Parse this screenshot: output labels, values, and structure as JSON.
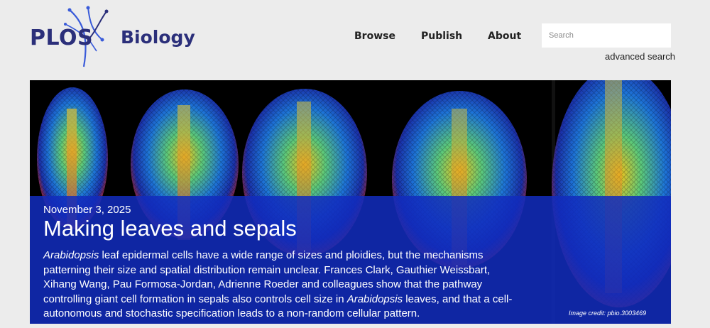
{
  "header": {
    "logo_text": "PLOS",
    "logo_journal": "Biology",
    "nav": {
      "browse": "Browse",
      "publish": "Publish",
      "about": "About"
    },
    "search": {
      "placeholder": "Search",
      "advanced_label": "advanced search"
    }
  },
  "featured": {
    "date": "November 3, 2025",
    "title": "Making leaves and sepals",
    "description": {
      "seg1_italic": "Arabidopsis",
      "seg2": " leaf epidermal cells have a wide range of sizes and ploidies, but the mechanisms patterning their size and spatial distribution remain unclear. Frances Clark, Gauthier Weissbart, Xihang Wang, Pau Formosa-Jordan, Adrienne Roeder and colleagues show that the pathway controlling giant cell formation in sepals also controls cell size in ",
      "seg3_italic": "Arabidopsis",
      "seg4": " leaves, and that a cell-autonomous and stochastic specification leads to a non-random cellular pattern."
    },
    "image_credit": "Image credit: pbio.3003469"
  },
  "colors": {
    "brand_navy": "#2b2f7a",
    "logo_accent": "#3a5bd9",
    "overlay_blue": "#122cbe",
    "page_bg": "#ececec"
  }
}
